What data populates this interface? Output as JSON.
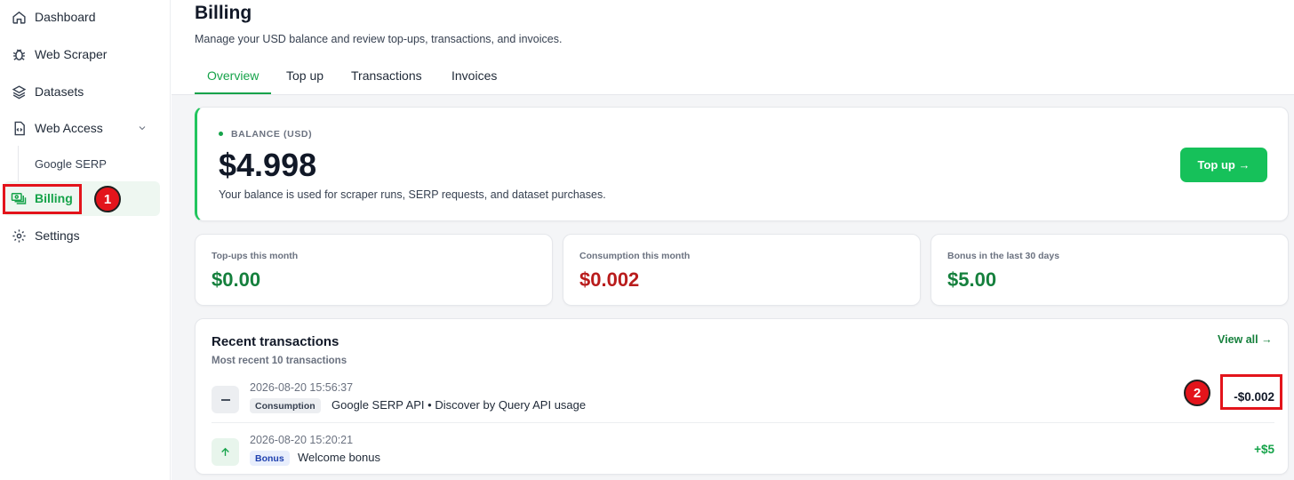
{
  "sidebar": {
    "items": [
      {
        "label": "Dashboard",
        "icon": "home-icon"
      },
      {
        "label": "Web Scraper",
        "icon": "bug-icon"
      },
      {
        "label": "Datasets",
        "icon": "layers-icon"
      },
      {
        "label": "Web Access",
        "icon": "file-code-icon"
      },
      {
        "label": "Google SERP"
      },
      {
        "label": "Billing",
        "icon": "money-stack-icon"
      },
      {
        "label": "Settings",
        "icon": "gear-icon"
      }
    ]
  },
  "markers": {
    "one": "1",
    "two": "2"
  },
  "header": {
    "title": "Billing",
    "subtitle": "Manage your USD balance and review top-ups, transactions, and invoices."
  },
  "tabs": [
    "Overview",
    "Top up",
    "Transactions",
    "Invoices"
  ],
  "balance": {
    "label": "BALANCE (USD)",
    "value": "$4.998",
    "note": "Your balance is used for scraper runs, SERP requests, and dataset purchases.",
    "button": "Top up →"
  },
  "stats": [
    {
      "label": "Top-ups this month",
      "value": "$0.00",
      "color": "#15803d"
    },
    {
      "label": "Consumption this month",
      "value": "$0.002",
      "color": "#b91c1c"
    },
    {
      "label": "Bonus in the last 30 days",
      "value": "$5.00",
      "color": "#15803d"
    }
  ],
  "transactions": {
    "title": "Recent transactions",
    "subtitle": "Most recent 10 transactions",
    "view_all": "View all →",
    "rows": [
      {
        "date": "2026-08-20 15:56:37",
        "type": "Consumption",
        "description": "Google SERP API • Discover by Query API usage",
        "amount": "-$0.002"
      },
      {
        "date": "2026-08-20 15:20:21",
        "type": "Bonus",
        "description": "Welcome bonus",
        "amount": "+$5"
      }
    ]
  },
  "colors": {
    "accent": "#16a34a",
    "highlight": "#e3141b"
  }
}
